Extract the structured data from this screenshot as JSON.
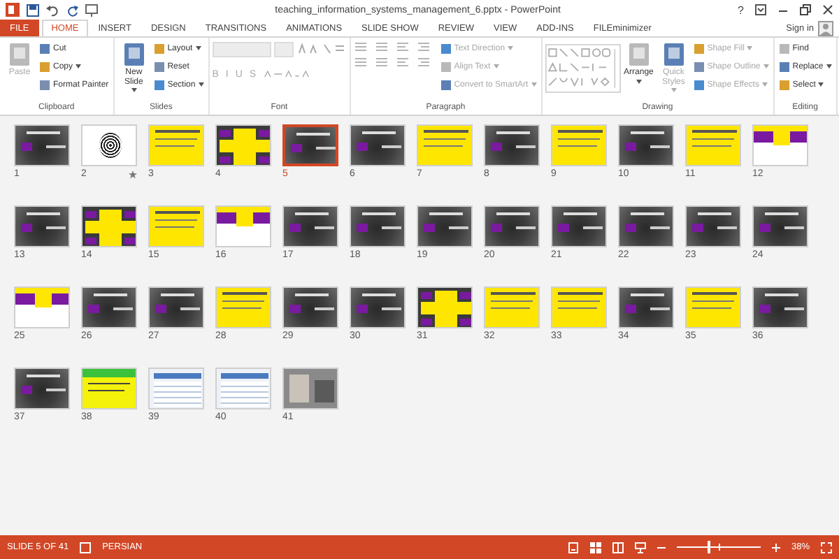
{
  "window": {
    "title": "teaching_information_systems_management_6.pptx - PowerPoint",
    "help": "?"
  },
  "tabs": [
    {
      "label": "FILE",
      "kind": "file",
      "selected": false
    },
    {
      "label": "HOME",
      "kind": "tab",
      "selected": true
    },
    {
      "label": "INSERT",
      "kind": "tab",
      "selected": false
    },
    {
      "label": "DESIGN",
      "kind": "tab",
      "selected": false
    },
    {
      "label": "TRANSITIONS",
      "kind": "tab",
      "selected": false
    },
    {
      "label": "ANIMATIONS",
      "kind": "tab",
      "selected": false
    },
    {
      "label": "SLIDE SHOW",
      "kind": "tab",
      "selected": false
    },
    {
      "label": "REVIEW",
      "kind": "tab",
      "selected": false
    },
    {
      "label": "VIEW",
      "kind": "tab",
      "selected": false
    },
    {
      "label": "ADD-INS",
      "kind": "tab",
      "selected": false
    },
    {
      "label": "FILEminimizer",
      "kind": "tab",
      "selected": false
    }
  ],
  "sign_in": "Sign in",
  "ribbon": [
    {
      "label": "Clipboard",
      "columns": [
        [
          {
            "label": "Paste",
            "kind": "large",
            "disabled": true,
            "dropdown": false
          }
        ],
        [
          {
            "label": "Cut",
            "kind": "small",
            "disabled": false,
            "dropdown": false
          },
          {
            "label": "Copy",
            "kind": "small",
            "disabled": false,
            "dropdown": true
          },
          {
            "label": "Format Painter",
            "kind": "small",
            "disabled": false,
            "dropdown": false
          }
        ]
      ]
    },
    {
      "label": "Slides",
      "columns": [
        [
          {
            "label": "New Slide",
            "kind": "large",
            "disabled": false,
            "dropdown": true
          }
        ],
        [
          {
            "label": "Layout",
            "kind": "small",
            "disabled": false,
            "dropdown": true
          },
          {
            "label": "Reset",
            "kind": "small",
            "disabled": false,
            "dropdown": false
          },
          {
            "label": "Section",
            "kind": "small",
            "disabled": false,
            "dropdown": true
          }
        ]
      ]
    },
    {
      "label": "Font",
      "columns": [
        [
          {
            "kind": "fields",
            "disabled": true
          },
          {
            "kind": "glyphs",
            "labels": [
              "B",
              "I",
              "U",
              "S"
            ],
            "disabled": true
          }
        ]
      ]
    },
    {
      "label": "Paragraph",
      "columns": [
        [
          {
            "kind": "icon-row",
            "disabled": true
          },
          {
            "kind": "icon-row",
            "disabled": true
          }
        ],
        [
          {
            "label": "Text Direction",
            "kind": "small",
            "disabled": true,
            "dropdown": true
          },
          {
            "label": "Align Text",
            "kind": "small",
            "disabled": true,
            "dropdown": true
          },
          {
            "label": "Convert to SmartArt",
            "kind": "small",
            "disabled": true,
            "dropdown": true
          }
        ]
      ]
    },
    {
      "label": "Drawing",
      "columns": [
        [
          {
            "kind": "gallery",
            "disabled": true
          }
        ],
        [
          {
            "label": "Arrange",
            "kind": "large",
            "disabled": false,
            "dropdown": true
          }
        ],
        [
          {
            "label": "Quick Styles",
            "kind": "large",
            "disabled": true,
            "dropdown": true
          }
        ],
        [
          {
            "label": "Shape Fill",
            "kind": "small",
            "disabled": true,
            "dropdown": true
          },
          {
            "label": "Shape Outline",
            "kind": "small",
            "disabled": true,
            "dropdown": true
          },
          {
            "label": "Shape Effects",
            "kind": "small",
            "disabled": true,
            "dropdown": true
          }
        ]
      ]
    },
    {
      "label": "Editing",
      "columns": [
        [
          {
            "label": "Find",
            "kind": "small",
            "disabled": false,
            "dropdown": false
          },
          {
            "label": "Replace",
            "kind": "small",
            "disabled": false,
            "dropdown": true
          },
          {
            "label": "Select",
            "kind": "small",
            "disabled": false,
            "dropdown": true
          }
        ]
      ]
    }
  ],
  "slides": [
    {
      "number": "1",
      "kind": "dark",
      "selected": false,
      "animated": false
    },
    {
      "number": "2",
      "kind": "pattern",
      "selected": false,
      "animated": true
    },
    {
      "number": "3",
      "kind": "yellow",
      "selected": false,
      "animated": false
    },
    {
      "number": "4",
      "kind": "mixed",
      "selected": false,
      "animated": false
    },
    {
      "number": "5",
      "kind": "dark",
      "selected": true,
      "animated": false
    },
    {
      "number": "6",
      "kind": "dark",
      "selected": false,
      "animated": false
    },
    {
      "number": "7",
      "kind": "yellow",
      "selected": false,
      "animated": false
    },
    {
      "number": "8",
      "kind": "dark",
      "selected": false,
      "animated": false
    },
    {
      "number": "9",
      "kind": "yellow",
      "selected": false,
      "animated": false
    },
    {
      "number": "10",
      "kind": "dark",
      "selected": false,
      "animated": false
    },
    {
      "number": "11",
      "kind": "yellow",
      "selected": false,
      "animated": false
    },
    {
      "number": "12",
      "kind": "white",
      "selected": false,
      "animated": false
    },
    {
      "number": "13",
      "kind": "dark",
      "selected": false,
      "animated": false
    },
    {
      "number": "14",
      "kind": "mixed",
      "selected": false,
      "animated": false
    },
    {
      "number": "15",
      "kind": "yellow",
      "selected": false,
      "animated": false
    },
    {
      "number": "16",
      "kind": "white",
      "selected": false,
      "animated": false
    },
    {
      "number": "17",
      "kind": "dark",
      "selected": false,
      "animated": false
    },
    {
      "number": "18",
      "kind": "dark",
      "selected": false,
      "animated": false
    },
    {
      "number": "19",
      "kind": "dark",
      "selected": false,
      "animated": false
    },
    {
      "number": "20",
      "kind": "dark",
      "selected": false,
      "animated": false
    },
    {
      "number": "21",
      "kind": "dark",
      "selected": false,
      "animated": false
    },
    {
      "number": "22",
      "kind": "dark",
      "selected": false,
      "animated": false
    },
    {
      "number": "23",
      "kind": "dark",
      "selected": false,
      "animated": false
    },
    {
      "number": "24",
      "kind": "dark",
      "selected": false,
      "animated": false
    },
    {
      "number": "25",
      "kind": "white",
      "selected": false,
      "animated": false
    },
    {
      "number": "26",
      "kind": "dark",
      "selected": false,
      "animated": false
    },
    {
      "number": "27",
      "kind": "dark",
      "selected": false,
      "animated": false
    },
    {
      "number": "28",
      "kind": "yellow",
      "selected": false,
      "animated": false
    },
    {
      "number": "29",
      "kind": "dark",
      "selected": false,
      "animated": false
    },
    {
      "number": "30",
      "kind": "dark",
      "selected": false,
      "animated": false
    },
    {
      "number": "31",
      "kind": "mixed",
      "selected": false,
      "animated": false
    },
    {
      "number": "32",
      "kind": "yellow",
      "selected": false,
      "animated": false
    },
    {
      "number": "33",
      "kind": "yellow",
      "selected": false,
      "animated": false
    },
    {
      "number": "34",
      "kind": "dark",
      "selected": false,
      "animated": false
    },
    {
      "number": "35",
      "kind": "yellow",
      "selected": false,
      "animated": false
    },
    {
      "number": "36",
      "kind": "dark",
      "selected": false,
      "animated": false
    },
    {
      "number": "37",
      "kind": "dark",
      "selected": false,
      "animated": false
    },
    {
      "number": "38",
      "kind": "green",
      "selected": false,
      "animated": false
    },
    {
      "number": "39",
      "kind": "table",
      "selected": false,
      "animated": false
    },
    {
      "number": "40",
      "kind": "table",
      "selected": false,
      "animated": false
    },
    {
      "number": "41",
      "kind": "photo",
      "selected": false,
      "animated": false
    }
  ],
  "status_bar": {
    "slide": "SLIDE 5 OF 41",
    "language": "PERSIAN",
    "zoom": "38%",
    "level": 0.38
  }
}
